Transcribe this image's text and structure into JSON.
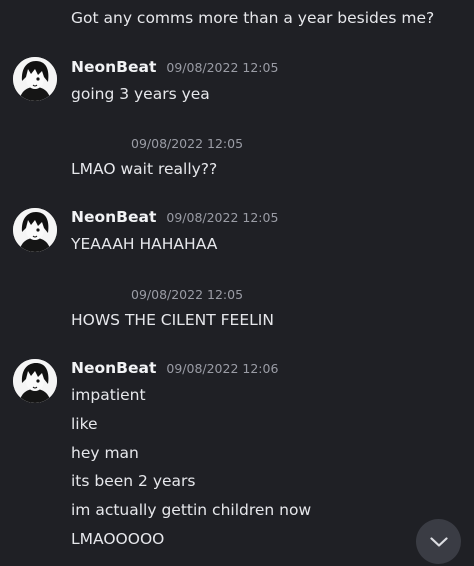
{
  "messages": {
    "m0": "Got any comms more than a year besides me?",
    "g1": {
      "username": "NeonBeat",
      "timestamp": "09/08/2022 12:05",
      "lines": [
        "going 3 years yea"
      ]
    },
    "g2": {
      "timestamp": "09/08/2022 12:05",
      "lines": [
        "LMAO wait really??"
      ]
    },
    "g3": {
      "username": "NeonBeat",
      "timestamp": "09/08/2022 12:05",
      "lines": [
        "YEAAAH HAHAHAA"
      ]
    },
    "g4": {
      "timestamp": "09/08/2022 12:05",
      "lines": [
        "HOWS THE CILENT FEELIN"
      ]
    },
    "g5": {
      "username": "NeonBeat",
      "timestamp": "09/08/2022 12:06",
      "lines": [
        "impatient",
        "like",
        "hey man",
        "its been 2 years",
        "im actually gettin children now",
        "LMAOOOOO"
      ]
    }
  },
  "icons": {
    "avatar": "anime-avatar-icon",
    "scroll": "chevron-down-icon"
  },
  "colors": {
    "background": "#1f2025",
    "timestamp": "#9a9ca5",
    "scroll_button": "#3a3c44"
  }
}
